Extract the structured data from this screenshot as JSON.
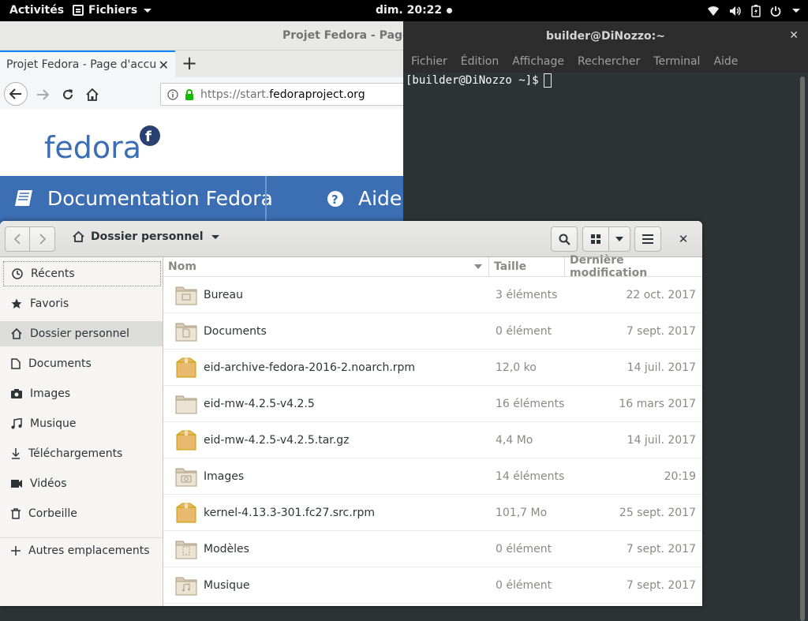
{
  "topbar": {
    "activities": "Activités",
    "app_name": "Fichiers",
    "clock": "dim. 20:22",
    "status_icons": [
      "wifi-icon",
      "volume-icon",
      "battery-icon",
      "power-icon"
    ]
  },
  "browser": {
    "window_title": "Projet Fedora - Page d'a",
    "tab_title": "Projet Fedora - Page d'accue",
    "url_scheme": "https://start.",
    "url_domain": "fedoraproject.org",
    "logo_text": "fedora",
    "nav_doc_label": "Documentation Fedora",
    "nav_help_label": "Aide",
    "accent_color": "#3c6eb4"
  },
  "terminal": {
    "title": "builder@DiNozzo:~",
    "menu": [
      "Fichier",
      "Édition",
      "Affichage",
      "Rechercher",
      "Terminal",
      "Aide"
    ],
    "prompt": "[builder@DiNozzo ~]$"
  },
  "files": {
    "location": "Dossier personnel",
    "sidebar": [
      {
        "label": "Récents",
        "icon": "clock-icon"
      },
      {
        "label": "Favoris",
        "icon": "star-icon"
      },
      {
        "label": "Dossier personnel",
        "icon": "home-icon"
      },
      {
        "label": "Documents",
        "icon": "document-icon"
      },
      {
        "label": "Images",
        "icon": "camera-icon"
      },
      {
        "label": "Musique",
        "icon": "music-icon"
      },
      {
        "label": "Téléchargements",
        "icon": "download-icon"
      },
      {
        "label": "Vidéos",
        "icon": "video-icon"
      },
      {
        "label": "Corbeille",
        "icon": "trash-icon"
      },
      {
        "label": "Autres emplacements",
        "icon": "plus-icon"
      }
    ],
    "columns": {
      "name": "Nom",
      "size": "Taille",
      "modified": "Dernière modification"
    },
    "rows": [
      {
        "name": "Bureau",
        "size": "3 éléments",
        "modified": "22 oct. 2017",
        "kind": "folder-desktop"
      },
      {
        "name": "Documents",
        "size": "0 élément",
        "modified": "7 sept. 2017",
        "kind": "folder-documents"
      },
      {
        "name": "eid-archive-fedora-2016-2.noarch.rpm",
        "size": "12,0 ko",
        "modified": "14 juil. 2017",
        "kind": "package"
      },
      {
        "name": "eid-mw-4.2.5-v4.2.5",
        "size": "16 éléments",
        "modified": "16 mars 2017",
        "kind": "folder"
      },
      {
        "name": "eid-mw-4.2.5-v4.2.5.tar.gz",
        "size": "4,4 Mo",
        "modified": "14 juil. 2017",
        "kind": "package"
      },
      {
        "name": "Images",
        "size": "14 éléments",
        "modified": "20:19",
        "kind": "folder-pictures"
      },
      {
        "name": "kernel-4.13.3-301.fc27.src.rpm",
        "size": "101,7 Mo",
        "modified": "25 sept. 2017",
        "kind": "package"
      },
      {
        "name": "Modèles",
        "size": "0 élément",
        "modified": "7 sept. 2017",
        "kind": "folder-templates"
      },
      {
        "name": "Musique",
        "size": "0 élément",
        "modified": "7 sept. 2017",
        "kind": "folder-music"
      }
    ]
  }
}
